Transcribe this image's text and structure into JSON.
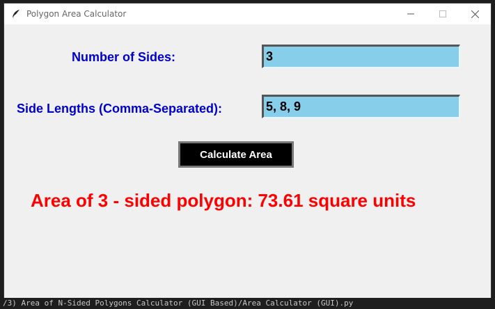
{
  "window": {
    "title": "Polygon Area Calculator",
    "icon": "feather-icon"
  },
  "form": {
    "sides_label": "Number of Sides:",
    "sides_value": "3",
    "lengths_label": "Side Lengths (Comma-Separated):",
    "lengths_value": "5, 8, 9",
    "calculate_label": "Calculate Area"
  },
  "result": {
    "text": "Area of 3 - sided polygon: 73.61 square units"
  },
  "background": {
    "editor_line": "/3) Area of N-Sided Polygons Calculator (GUI Based)/Area Calculator (GUI).py"
  },
  "colors": {
    "label": "#0000cc",
    "entry_bg": "#87ceeb",
    "button_bg": "#000000",
    "result": "#ff0000"
  }
}
